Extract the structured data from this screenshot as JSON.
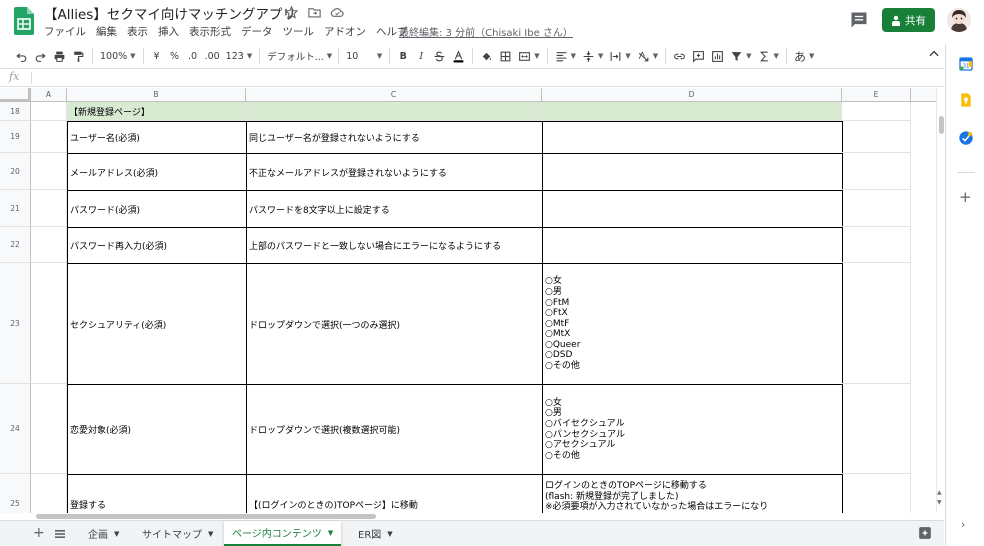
{
  "header": {
    "title": "【Allies】セクマイ向けマッチングアプリ",
    "last_edit": "最終編集: 3 分前（Chisaki Ibe さん）",
    "share_label": "共有",
    "menu": [
      "ファイル",
      "編集",
      "表示",
      "挿入",
      "表示形式",
      "データ",
      "ツール",
      "アドオン",
      "ヘルプ"
    ]
  },
  "toolbar": {
    "zoom": "100%",
    "currency": "¥",
    "percent": "%",
    "dec_decrease": ".0",
    "dec_increase": ".00",
    "number_format": "123",
    "font": "デフォルト...",
    "font_size": "10",
    "bold": "B",
    "italic": "I",
    "input_tool": "あ"
  },
  "formula": {
    "label": "fx",
    "value": ""
  },
  "columns": [
    "A",
    "B",
    "C",
    "D",
    "E"
  ],
  "rows": [
    {
      "num": "18",
      "b": "【新規登録ページ】",
      "c": "",
      "d": []
    },
    {
      "num": "19",
      "b": "ユーザー名(必須)",
      "c": "同じユーザー名が登録されないようにする",
      "d": []
    },
    {
      "num": "20",
      "b": "メールアドレス(必須)",
      "c": "不正なメールアドレスが登録されないようにする",
      "d": []
    },
    {
      "num": "21",
      "b": "パスワード(必須)",
      "c": "パスワードを8文字以上に設定する",
      "d": []
    },
    {
      "num": "22",
      "b": "パスワード再入力(必須)",
      "c": "上部のパスワードと一致しない場合にエラーになるようにする",
      "d": []
    },
    {
      "num": "23",
      "b": "セクシュアリティ(必須)",
      "c": "ドロップダウンで選択(一つのみ選択)",
      "d": [
        "○女",
        "○男",
        "○FtM",
        "○FtX",
        "○MtF",
        "○MtX",
        "○Queer",
        "○DSD",
        "○その他"
      ]
    },
    {
      "num": "24",
      "b": "恋愛対象(必須)",
      "c": "ドロップダウンで選択(複数選択可能)",
      "d": [
        "○女",
        "○男",
        "○バイセクシュアル",
        "○パンセクシュアル",
        "○アセクシュアル",
        "○その他"
      ]
    },
    {
      "num": "25",
      "b": "登録する",
      "c": "【(ログインのときの)TOPページ】に移動",
      "d": [
        "ログインのときのTOPページに移動する",
        "(flash: 新規登録が完了しました)",
        "※必須要項が入力されていなかった場合はエラーになり"
      ]
    }
  ],
  "sheets": [
    "企画",
    "サイトマップ",
    "ページ内コンテンツ",
    "ER図"
  ],
  "active_sheet": 2,
  "colors": {
    "accent_green": "#188038",
    "header_green": "#d9ead3"
  }
}
